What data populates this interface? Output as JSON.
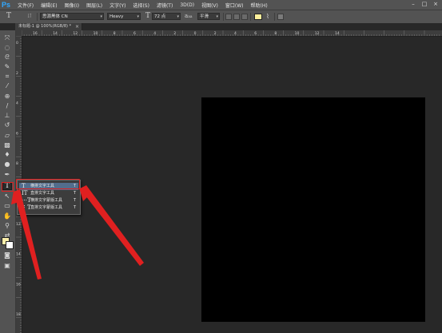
{
  "app": {
    "logo": "Ps",
    "menus": [
      "文件(F)",
      "编辑(E)",
      "图像(I)",
      "图层(L)",
      "文字(Y)",
      "选择(S)",
      "滤镜(T)",
      "3D(D)",
      "视图(V)",
      "窗口(W)",
      "帮助(H)"
    ],
    "window_controls": {
      "minimize": "–",
      "maximize": "□",
      "close": "×"
    }
  },
  "options_bar": {
    "tool_glyph": "T",
    "orient_glyph": "⇵",
    "font_family": "思源黑体 CN",
    "font_style": "Heavy",
    "size_glyph": "T",
    "font_size": "72 点",
    "aa_glyph": "a",
    "aa_label": "aa",
    "antialias": "平滑",
    "warp_glyph": "⌇",
    "text_color": "#fcef9c"
  },
  "document": {
    "tab_title": "未标题-1 @ 100%(RGB/8) *",
    "close_glyph": "×",
    "canvas_color": "#000000"
  },
  "rulers": {
    "top_labels": [
      "16",
      "14",
      "12",
      "10",
      "8",
      "6",
      "4",
      "2",
      "0",
      "2",
      "4",
      "6",
      "8",
      "10",
      "12",
      "14"
    ],
    "left_labels": [
      "0",
      "2",
      "4",
      "6",
      "8",
      "10",
      "12",
      "14",
      "16",
      "18"
    ]
  },
  "toolbox": {
    "tools": [
      {
        "name": "move-tool-icon",
        "glyph": "⤧"
      },
      {
        "name": "marquee-tool-icon",
        "glyph": "◌"
      },
      {
        "name": "lasso-tool-icon",
        "glyph": "ᘓ"
      },
      {
        "name": "quick-select-tool-icon",
        "glyph": "✎"
      },
      {
        "name": "crop-tool-icon",
        "glyph": "⌗"
      },
      {
        "name": "eyedropper-tool-icon",
        "glyph": "⁄"
      },
      {
        "name": "healing-brush-tool-icon",
        "glyph": "⊕"
      },
      {
        "name": "brush-tool-icon",
        "glyph": "/"
      },
      {
        "name": "clone-stamp-tool-icon",
        "glyph": "⊥"
      },
      {
        "name": "history-brush-tool-icon",
        "glyph": "↺"
      },
      {
        "name": "eraser-tool-icon",
        "glyph": "▱"
      },
      {
        "name": "gradient-tool-icon",
        "glyph": "▩"
      },
      {
        "name": "blur-tool-icon",
        "glyph": "♦"
      },
      {
        "name": "dodge-tool-icon",
        "glyph": "●"
      },
      {
        "name": "pen-tool-icon",
        "glyph": "✒"
      },
      {
        "name": "type-tool-icon",
        "glyph": "T"
      },
      {
        "name": "path-selection-tool-icon",
        "glyph": "↖"
      },
      {
        "name": "shape-tool-icon",
        "glyph": "▭"
      },
      {
        "name": "hand-tool-icon",
        "glyph": "✋"
      },
      {
        "name": "zoom-tool-icon",
        "glyph": "⚲"
      },
      {
        "name": "default-colors-icon",
        "glyph": "⇄"
      },
      {
        "name": "quick-mask-icon",
        "glyph": "◙"
      },
      {
        "name": "screen-mode-icon",
        "glyph": "▣"
      }
    ],
    "foreground_color": "#fcefaa",
    "background_color": "#ffffff"
  },
  "type_flyout": {
    "items": [
      {
        "icon": "T",
        "label": "横排文字工具",
        "shortcut": "T",
        "selected": true
      },
      {
        "icon": "IT",
        "label": "直排文字工具",
        "shortcut": "T",
        "selected": false
      },
      {
        "icon": "⋯T",
        "label": "横排文字蒙版工具",
        "shortcut": "T",
        "selected": false
      },
      {
        "icon": "⋮T",
        "label": "直排文字蒙版工具",
        "shortcut": "T",
        "selected": false
      }
    ]
  },
  "annotation": {
    "color": "#e02020"
  }
}
